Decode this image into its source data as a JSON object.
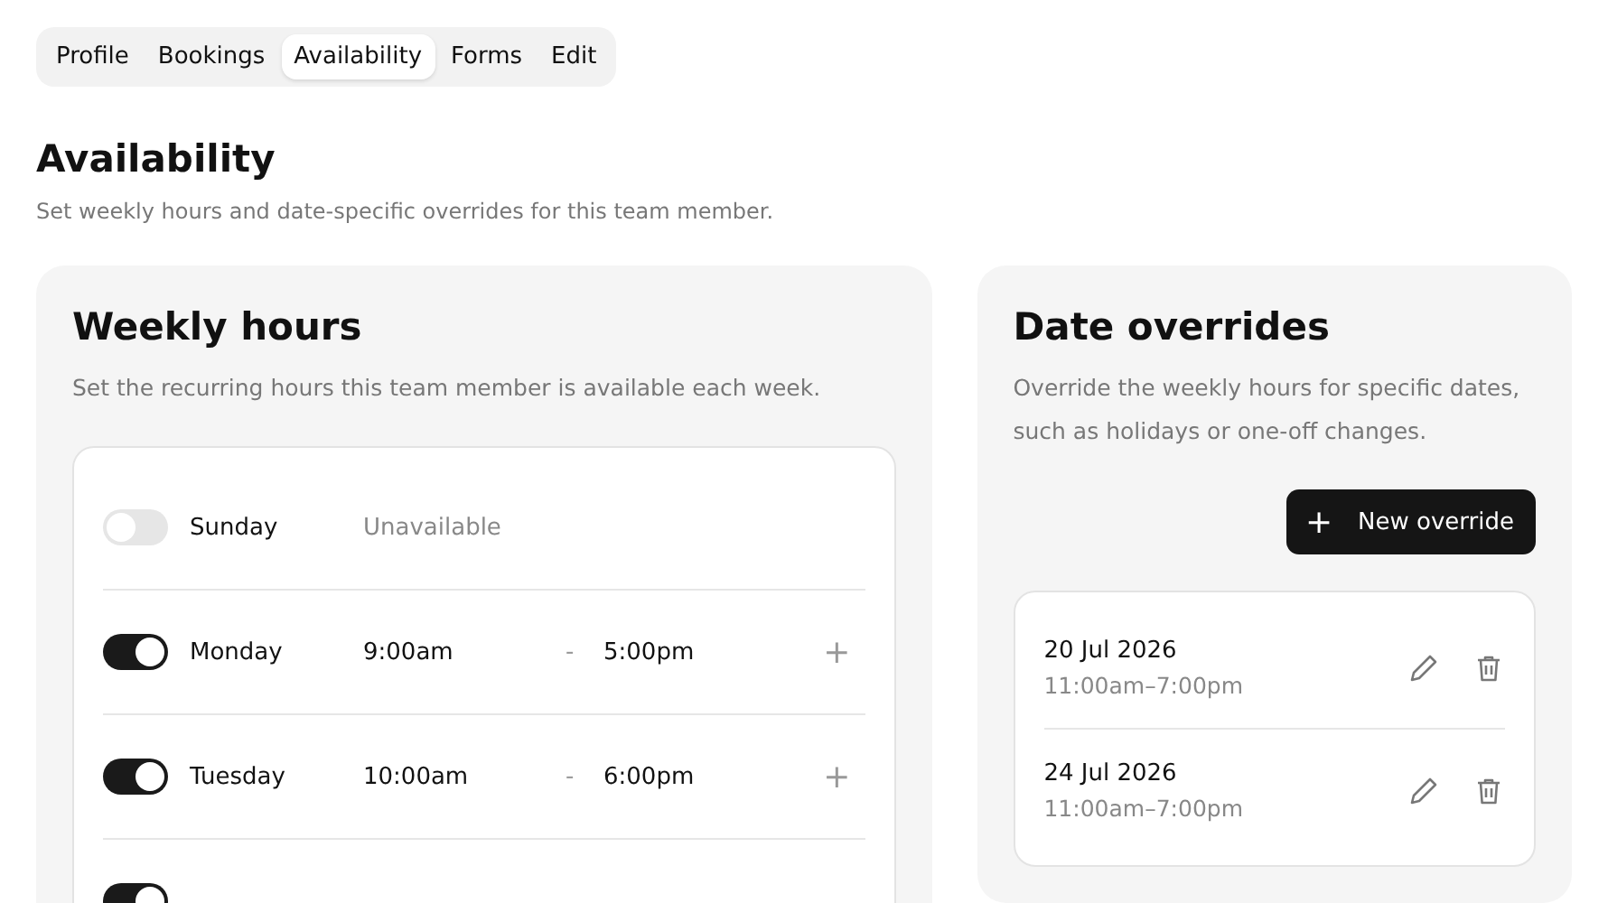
{
  "tabs": [
    {
      "label": "Profile",
      "selected": false
    },
    {
      "label": "Bookings",
      "selected": false
    },
    {
      "label": "Availability",
      "selected": true
    },
    {
      "label": "Forms",
      "selected": false
    },
    {
      "label": "Edit",
      "selected": false
    }
  ],
  "page": {
    "title": "Availability",
    "subtitle": "Set weekly hours and date-specific overrides for this team member."
  },
  "weekly_hours": {
    "title": "Weekly hours",
    "description": "Set the recurring hours this team member is available each week.",
    "days": [
      {
        "name": "Sunday",
        "on": false,
        "status": "Unavailable"
      },
      {
        "name": "Monday",
        "on": true,
        "start": "9:00am",
        "separator": "-",
        "end": "5:00pm",
        "add": "+"
      },
      {
        "name": "Tuesday",
        "on": true,
        "start": "10:00am",
        "separator": "-",
        "end": "6:00pm",
        "add": "+"
      },
      {
        "on": true
      }
    ]
  },
  "date_overrides": {
    "title": "Date overrides",
    "description": "Override the weekly hours for specific dates, such as holidays or one-off changes.",
    "button": {
      "icon": "+",
      "label": "New override"
    },
    "items": [
      {
        "date": "20 Jul 2026",
        "hours": "11:00am–7:00pm"
      },
      {
        "date": "24 Jul 2026",
        "hours": "11:00am–7:00pm"
      }
    ]
  }
}
